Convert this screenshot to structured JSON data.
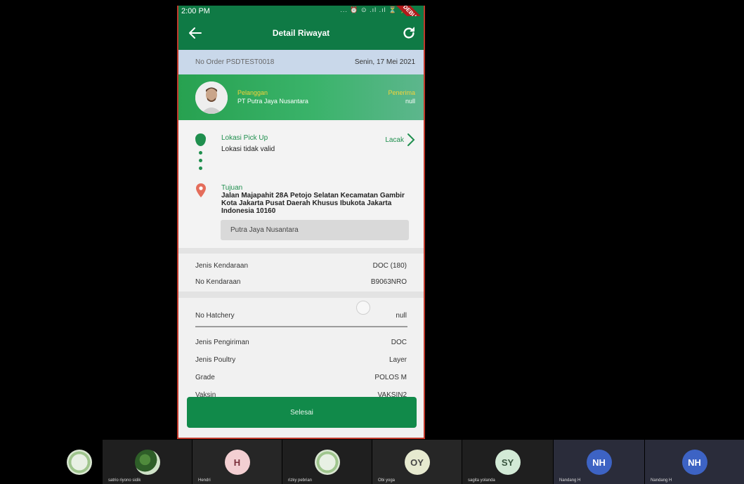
{
  "status_bar": {
    "time": "2:00 PM",
    "icons": "... ⏰ ⊙ .ıl .ıl ⏳ ⚡",
    "debug_label": "DEBUG"
  },
  "app_bar": {
    "title": "Detail Riwayat",
    "back_icon": "arrow-left-icon",
    "refresh_icon": "refresh-icon"
  },
  "order": {
    "number": "No Order PSDTEST0018",
    "date": "Senin, 17 Mei 2021"
  },
  "customer": {
    "label": "Pelanggan",
    "name": "PT Putra Jaya Nusantara",
    "receiver_label": "Penerima",
    "receiver_value": "null"
  },
  "pickup": {
    "label": "Lokasi Pick Up",
    "value": "Lokasi tidak valid",
    "track_label": "Lacak"
  },
  "destination": {
    "label": "Tujuan",
    "address": "Jalan Majapahit 28A Petojo Selatan Kecamatan Gambir Kota Jakarta Pusat Daerah Khusus Ibukota Jakarta Indonesia 10160",
    "name": "Putra Jaya Nusantara"
  },
  "vehicle": {
    "type_label": "Jenis Kendaraan",
    "type_value": "DOC (180)",
    "number_label": "No Kendaraan",
    "number_value": "B9063NRO"
  },
  "hatchery": {
    "label": "No Hatchery",
    "value": "null"
  },
  "details": [
    {
      "label": "Jenis Pengiriman",
      "value": "DOC"
    },
    {
      "label": "Jenis Poultry",
      "value": "Layer"
    },
    {
      "label": "Grade",
      "value": "POLOS M"
    },
    {
      "label": "Vaksin",
      "value": "VAKSIN2"
    }
  ],
  "finish_button": "Selesai",
  "participants": [
    {
      "name": "",
      "initials": "",
      "avatar": "photo"
    },
    {
      "name": "satrio riyono sidik",
      "initials": "",
      "avatar": "photo"
    },
    {
      "name": "Hendri",
      "initials": "H",
      "color": "#f3cfd2",
      "text_color": "#7a2f3a"
    },
    {
      "name": "rizky pebrian",
      "initials": "",
      "avatar": "photo"
    },
    {
      "name": "Obi yoga",
      "initials": "OY",
      "color": "#e6e9cf",
      "text_color": "#444"
    },
    {
      "name": "sagita yolanda",
      "initials": "SY",
      "color": "#d2ead6",
      "text_color": "#37543d"
    },
    {
      "name": "Nandang H",
      "initials": "NH",
      "color": "#3d63c4",
      "text_color": "#fff"
    },
    {
      "name": "Nandang H",
      "initials": "NH",
      "color": "#3d63c4",
      "text_color": "#fff"
    }
  ]
}
